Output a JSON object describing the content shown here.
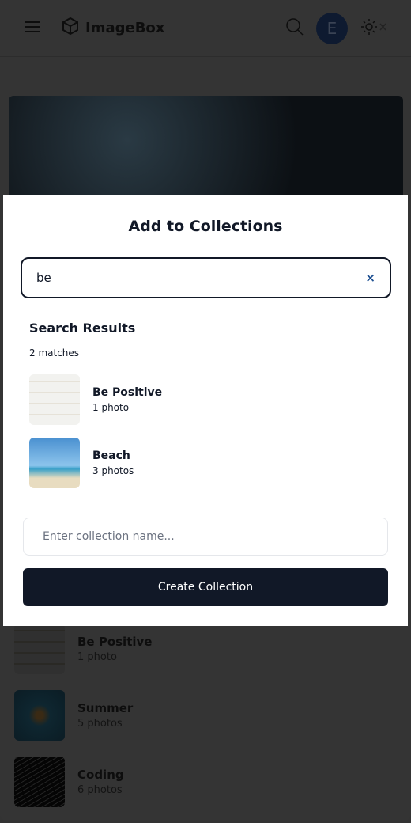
{
  "header": {
    "title": "ImageBox",
    "avatar_initial": "E"
  },
  "background_list": [
    {
      "title": "Be Positive",
      "sub": "1 photo"
    },
    {
      "title": "Summer",
      "sub": "5 photos"
    },
    {
      "title": "Coding",
      "sub": "6 photos"
    }
  ],
  "modal": {
    "title": "Add to Collections",
    "search_value": "be",
    "clear_label": "×",
    "results_heading": "Search Results",
    "match_count": "2 matches",
    "results": [
      {
        "title": "Be Positive",
        "sub": "1 photo"
      },
      {
        "title": "Beach",
        "sub": "3 photos"
      }
    ],
    "new_collection_placeholder": "Enter collection name...",
    "create_label": "Create Collection"
  },
  "colors": {
    "primary": "#111827",
    "accent": "#1d4f91"
  }
}
